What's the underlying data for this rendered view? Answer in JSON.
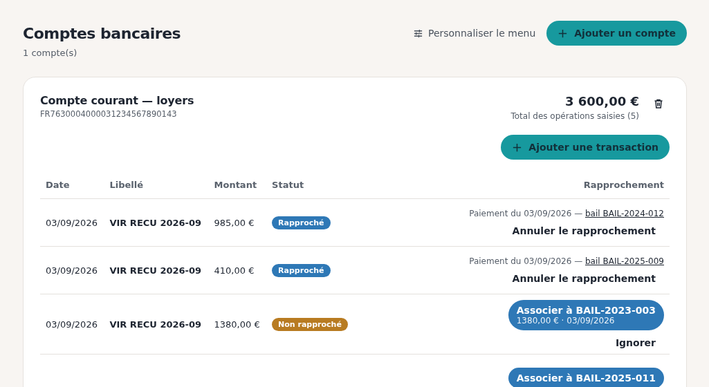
{
  "page": {
    "title": "Comptes bancaires",
    "subtitle": "1 compte(s)"
  },
  "toolbar": {
    "customize_label": "Personnaliser le menu",
    "add_account_label": "Ajouter un compte"
  },
  "account": {
    "name": "Compte courant — loyers",
    "iban": "FR7630004000031234567890143",
    "total": "3 600,00 €",
    "total_caption": "Total des opérations saisies (5)",
    "add_transaction_label": "Ajouter une transaction",
    "table": {
      "columns": [
        "Date",
        "Libellé",
        "Montant",
        "Statut",
        "Rapprochement"
      ],
      "rows": [
        {
          "date": "03/09/2026",
          "label": "VIR RECU 2026-09",
          "amount": "985,00 €",
          "status": {
            "text": "Rapproché",
            "kind": "matched"
          },
          "reconciliation": {
            "kind": "matched",
            "text": "Paiement du 03/09/2026 —",
            "link": "bail BAIL-2024-012",
            "action": "Annuler le rapprochement"
          }
        },
        {
          "date": "03/09/2026",
          "label": "VIR RECU 2026-09",
          "amount": "410,00 €",
          "status": {
            "text": "Rapproché",
            "kind": "matched"
          },
          "reconciliation": {
            "kind": "matched",
            "text": "Paiement du 03/09/2026 —",
            "link": "bail BAIL-2025-009",
            "action": "Annuler le rapprochement"
          }
        },
        {
          "date": "03/09/2026",
          "label": "VIR RECU 2026-09",
          "amount": "1380,00 €",
          "status": {
            "text": "Non rapproché",
            "kind": "unmatched"
          },
          "reconciliation": {
            "kind": "suggestion",
            "button_title": "Associer à BAIL-2023-003",
            "button_detail": "1380,00 € · 03/09/2026",
            "action": "Ignorer"
          }
        },
        {
          "reconciliation": {
            "kind": "suggestion",
            "button_title": "Associer à BAIL-2025-011"
          }
        }
      ]
    }
  }
}
